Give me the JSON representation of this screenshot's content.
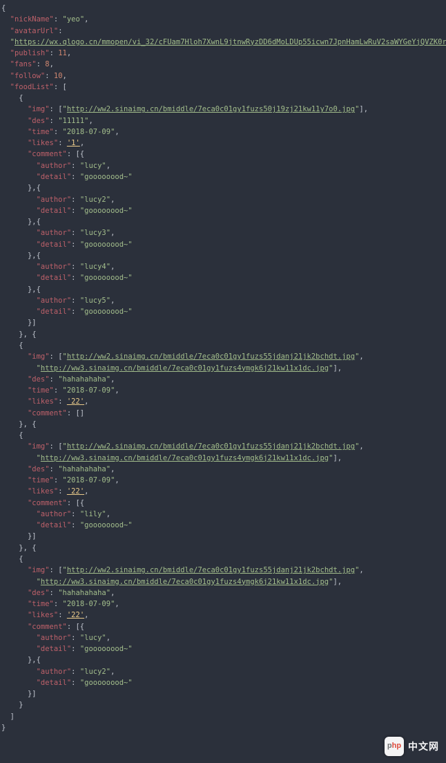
{
  "watermark": {
    "logo_left": "p",
    "logo_right": "hp",
    "text": "中文网"
  },
  "json": {
    "nickName": "yeo",
    "avatarUrl": "https://wx.qlogo.cn/mmopen/vi_32/cFUam7Hloh7XwnL9jtnwRyzDD6dMoLDUp55icwn7JpnHamLwRuV2saWYGeYjQVZK0rs209gk2dr4aaH0p40wbow/132",
    "publish": 11,
    "fans": 8,
    "follow": 10,
    "foodList": [
      {
        "img": [
          "http://ww2.sinaimg.cn/bmiddle/7eca0c01gy1fuzs50j19zj21kw11y7o0.jpg"
        ],
        "des": "11111",
        "time": "2018-07-09",
        "likes": "'1'",
        "comment": [
          {
            "author": "lucy",
            "detail": "goooooood~"
          },
          {
            "author": "lucy2",
            "detail": "goooooood~"
          },
          {
            "author": "lucy3",
            "detail": "goooooood~"
          },
          {
            "author": "lucy4",
            "detail": "goooooood~"
          },
          {
            "author": "lucy5",
            "detail": "goooooood~"
          }
        ]
      },
      {
        "img": [
          "http://ww2.sinaimg.cn/bmiddle/7eca0c01gy1fuzs55jdanj21jk2bchdt.jpg",
          "http://ww3.sinaimg.cn/bmiddle/7eca0c01gy1fuzs4ymgk6j21kw11x1dc.jpg"
        ],
        "des": "hahahahaha",
        "time": "2018-07-09",
        "likes": "'22'",
        "comment": []
      },
      {
        "img": [
          "http://ww2.sinaimg.cn/bmiddle/7eca0c01gy1fuzs55jdanj21jk2bchdt.jpg",
          "http://ww3.sinaimg.cn/bmiddle/7eca0c01gy1fuzs4ymgk6j21kw11x1dc.jpg"
        ],
        "des": "hahahahaha",
        "time": "2018-07-09",
        "likes": "'22'",
        "comment": [
          {
            "author": "lily",
            "detail": "goooooood~"
          }
        ]
      },
      {
        "img": [
          "http://ww2.sinaimg.cn/bmiddle/7eca0c01gy1fuzs55jdanj21jk2bchdt.jpg",
          "http://ww3.sinaimg.cn/bmiddle/7eca0c01gy1fuzs4ymgk6j21kw11x1dc.jpg"
        ],
        "des": "hahahahaha",
        "time": "2018-07-09",
        "likes": "'22'",
        "comment": [
          {
            "author": "lucy",
            "detail": "goooooood~"
          },
          {
            "author": "lucy2",
            "detail": "goooooood~"
          }
        ]
      }
    ]
  }
}
